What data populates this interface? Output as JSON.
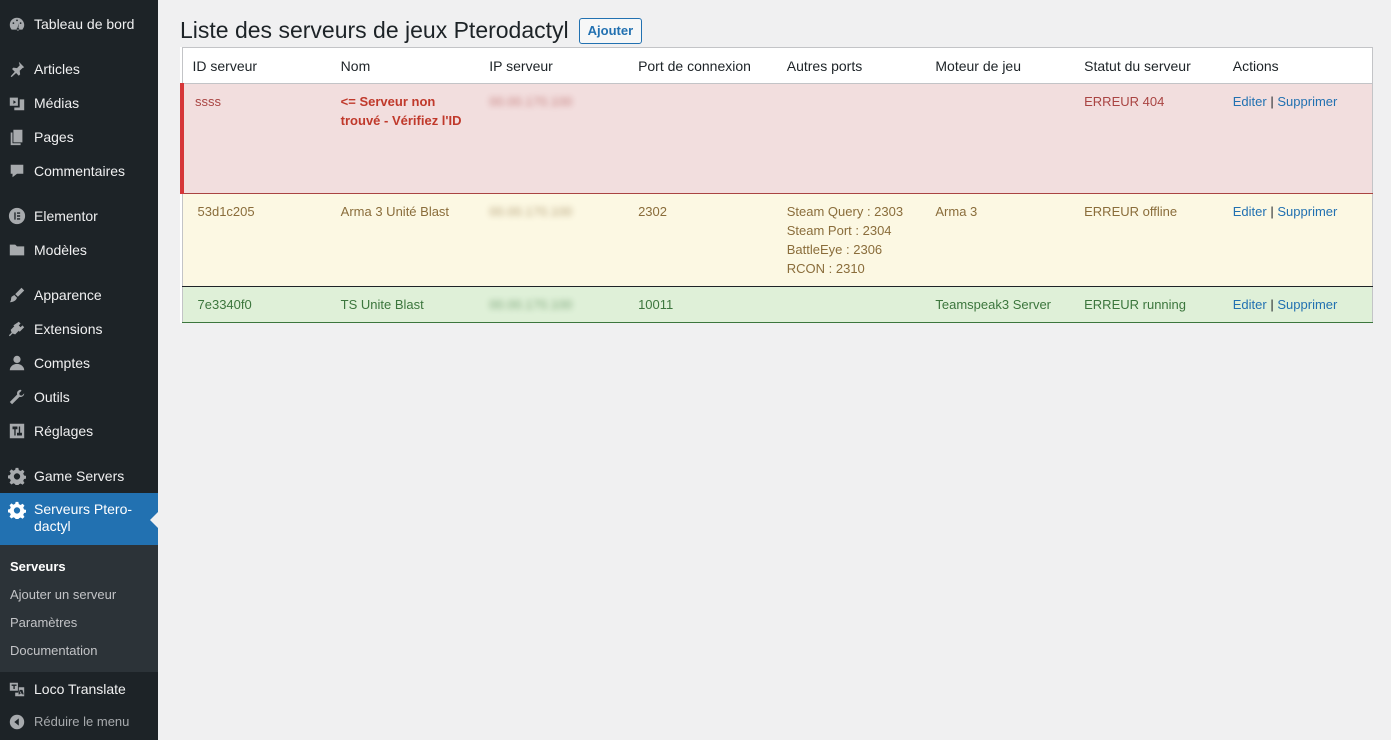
{
  "sidebar": {
    "items": [
      {
        "label": "Tableau de bord",
        "icon": "dashboard-icon"
      },
      {
        "label": "Articles",
        "icon": "pin-icon"
      },
      {
        "label": "Médias",
        "icon": "media-icon"
      },
      {
        "label": "Pages",
        "icon": "pages-icon"
      },
      {
        "label": "Commentaires",
        "icon": "comment-icon"
      },
      {
        "label": "Elementor",
        "icon": "elementor-icon"
      },
      {
        "label": "Modèles",
        "icon": "folder-icon"
      },
      {
        "label": "Apparence",
        "icon": "brush-icon"
      },
      {
        "label": "Extensions",
        "icon": "plugin-icon"
      },
      {
        "label": "Comptes",
        "icon": "user-icon"
      },
      {
        "label": "Outils",
        "icon": "wrench-icon"
      },
      {
        "label": "Réglages",
        "icon": "settings-icon"
      },
      {
        "label": "Game Servers",
        "icon": "gear-icon"
      },
      {
        "label": "Serveurs Ptero-dactyl",
        "icon": "gear-icon"
      },
      {
        "label": "Loco Translate",
        "icon": "translate-icon"
      }
    ],
    "submenu": [
      "Serveurs",
      "Ajouter un serveur",
      "Paramètres",
      "Documentation"
    ],
    "collapse_label": "Réduire le menu"
  },
  "page": {
    "title": "Liste des serveurs de jeux Pterodactyl",
    "add_label": "Ajouter"
  },
  "table": {
    "headers": [
      "ID serveur",
      "Nom",
      "IP serveur",
      "Port de connexion",
      "Autres ports",
      "Moteur de jeu",
      "Statut du serveur",
      "Actions"
    ],
    "rows": [
      {
        "id": "ssss",
        "name": "<= Serveur non trouvé - Vérifiez l'ID",
        "ip": "00.00.170.100",
        "port": "",
        "other_ports": [],
        "engine": "",
        "status": "ERREUR 404",
        "edit": "Editer",
        "delete": "Supprimer"
      },
      {
        "id": "53d1c205",
        "name": "Arma 3 Unité Blast",
        "ip": "00.00.170.100",
        "port": "2302",
        "other_ports": [
          "Steam Query : 2303",
          "Steam Port : 2304",
          "BattleEye : 2306",
          "RCON : 2310"
        ],
        "engine": "Arma 3",
        "status": "ERREUR offline",
        "edit": "Editer",
        "delete": "Supprimer"
      },
      {
        "id": "7e3340f0",
        "name": "TS Unite Blast",
        "ip": "00.00.170.100",
        "port": "10011",
        "other_ports": [],
        "engine": "Teamspeak3 Server",
        "status": "ERREUR running",
        "edit": "Editer",
        "delete": "Supprimer"
      }
    ],
    "separator": "|"
  },
  "colors": {
    "sidebar_bg": "#1d2327",
    "accent": "#2271b1",
    "error_row": "#f2dede",
    "warning_row": "#fcf8e3",
    "success_row": "#dff0d8"
  }
}
